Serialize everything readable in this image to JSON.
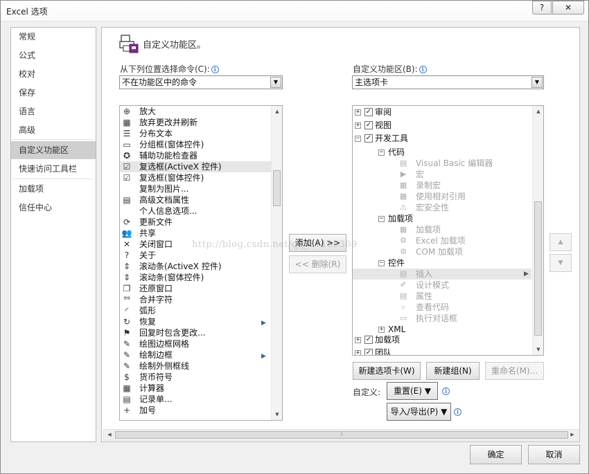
{
  "window": {
    "title": "Excel 选项",
    "help_label": "?",
    "close_label": "✕"
  },
  "nav": {
    "items": [
      {
        "label": "常规"
      },
      {
        "label": "公式"
      },
      {
        "label": "校对"
      },
      {
        "label": "保存"
      },
      {
        "label": "语言"
      },
      {
        "label": "高级"
      },
      {
        "label": "自定义功能区",
        "selected": true
      },
      {
        "label": "快速访问工具栏"
      },
      {
        "label": "加载项"
      },
      {
        "label": "信任中心"
      }
    ]
  },
  "main": {
    "heading": "自定义功能区。",
    "heading_icon": "ribbon-customize-icon",
    "choose_from_label": "从下列位置选择命令(C):",
    "choose_from_value": "不在功能区中的命令",
    "customize_ribbon_label": "自定义功能区(B):",
    "customize_ribbon_value": "主选项卡",
    "info_icon_glyph": "i",
    "combo_arrow_glyph": "▼",
    "commands": [
      {
        "label": "放大",
        "icon": "zoom-in-icon",
        "glyph": "⊕"
      },
      {
        "label": "放弃更改并刷新",
        "icon": "discard-refresh-icon",
        "glyph": "▦"
      },
      {
        "label": "分布文本",
        "icon": "distribute-text-icon",
        "glyph": "☰"
      },
      {
        "label": "分组框(窗体控件)",
        "icon": "group-box-icon",
        "glyph": "▭"
      },
      {
        "label": "辅助功能检查器",
        "icon": "accessibility-icon",
        "glyph": "✪"
      },
      {
        "label": "复选框(ActiveX 控件)",
        "icon": "checkbox-activex-icon",
        "glyph": "☑",
        "highlighted": true
      },
      {
        "label": "复选框(窗体控件)",
        "icon": "checkbox-form-icon",
        "glyph": "☑"
      },
      {
        "label": "复制为图片...",
        "icon": "",
        "glyph": ""
      },
      {
        "label": "高级文档属性",
        "icon": "doc-properties-icon",
        "glyph": "▤"
      },
      {
        "label": "个人信息选项...",
        "icon": "",
        "glyph": ""
      },
      {
        "label": "更新文件",
        "icon": "update-file-icon",
        "glyph": "⟳"
      },
      {
        "label": "共享",
        "icon": "share-icon",
        "glyph": "👥"
      },
      {
        "label": "关闭窗口",
        "icon": "close-window-icon",
        "glyph": "✕"
      },
      {
        "label": "关于",
        "icon": "about-icon",
        "glyph": "?"
      },
      {
        "label": "滚动条(ActiveX 控件)",
        "icon": "scrollbar-activex-icon",
        "glyph": "⇕"
      },
      {
        "label": "滚动条(窗体控件)",
        "icon": "scrollbar-form-icon",
        "glyph": "⇕"
      },
      {
        "label": "还原窗口",
        "icon": "restore-window-icon",
        "glyph": "❐"
      },
      {
        "label": "合并字符",
        "icon": "combine-chars-icon",
        "glyph": "⁹⁹"
      },
      {
        "label": "弧形",
        "icon": "arc-icon",
        "glyph": "◜"
      },
      {
        "label": "恢复",
        "icon": "recover-icon",
        "glyph": "↻",
        "submenu": true
      },
      {
        "label": "回复时包含更改...",
        "icon": "reply-changes-icon",
        "glyph": "⚑"
      },
      {
        "label": "绘图边框网格",
        "icon": "draw-border-grid-icon",
        "glyph": "✎"
      },
      {
        "label": "绘制边框",
        "icon": "draw-border-icon",
        "glyph": "✎",
        "submenu": true
      },
      {
        "label": "绘制外侧框线",
        "icon": "draw-outside-border-icon",
        "glyph": "✎"
      },
      {
        "label": "货币符号",
        "icon": "currency-icon",
        "glyph": "$"
      },
      {
        "label": "计算器",
        "icon": "calculator-icon",
        "glyph": "▦"
      },
      {
        "label": "记录单...",
        "icon": "form-icon",
        "glyph": "▤"
      },
      {
        "label": "加号",
        "icon": "plus-icon",
        "glyph": "+"
      }
    ],
    "add_button": "添加(A) >>",
    "remove_button": "<< 删除(R)",
    "tree": [
      {
        "label": "审阅",
        "level": 0,
        "expander": "+",
        "checked": true
      },
      {
        "label": "视图",
        "level": 0,
        "expander": "+",
        "checked": true
      },
      {
        "label": "开发工具",
        "level": 0,
        "expander": "−",
        "checked": true
      },
      {
        "label": "代码",
        "level": 1,
        "expander": "−"
      },
      {
        "label": "Visual Basic 编辑器",
        "level": 2,
        "icon": "vba-editor-icon",
        "glyph": "▤"
      },
      {
        "label": "宏",
        "level": 2,
        "icon": "macro-icon",
        "glyph": "▶"
      },
      {
        "label": "录制宏",
        "level": 2,
        "icon": "record-macro-icon",
        "glyph": "▦"
      },
      {
        "label": "使用相对引用",
        "level": 2,
        "icon": "relative-ref-icon",
        "glyph": "▦"
      },
      {
        "label": "宏安全性",
        "level": 2,
        "icon": "macro-security-icon",
        "glyph": "⚠"
      },
      {
        "label": "加载项",
        "level": 1,
        "expander": "−"
      },
      {
        "label": "加载项",
        "level": 2,
        "icon": "addins-icon",
        "glyph": "▦"
      },
      {
        "label": "Excel 加载项",
        "level": 2,
        "icon": "excel-addins-icon",
        "glyph": "⚙"
      },
      {
        "label": "COM 加载项",
        "level": 2,
        "icon": "com-addins-icon",
        "glyph": "⚙"
      },
      {
        "label": "控件",
        "level": 1,
        "expander": "−"
      },
      {
        "label": "插入",
        "level": 2,
        "icon": "insert-control-icon",
        "glyph": "▤",
        "highlighted": true,
        "submenu": true
      },
      {
        "label": "设计模式",
        "level": 2,
        "icon": "design-mode-icon",
        "glyph": "✐"
      },
      {
        "label": "属性",
        "level": 2,
        "icon": "properties-icon",
        "glyph": "▤"
      },
      {
        "label": "查看代码",
        "level": 2,
        "icon": "view-code-icon",
        "glyph": "⌕"
      },
      {
        "label": "执行对话框",
        "level": 2,
        "icon": "run-dialog-icon",
        "glyph": "▭"
      },
      {
        "label": "XML",
        "level": 1,
        "expander": "+"
      },
      {
        "label": "加载项",
        "level": 0,
        "expander": "+",
        "checked": true
      },
      {
        "label": "团队",
        "level": 0,
        "expander": "+",
        "checked": true
      }
    ],
    "new_tab_button": "新建选项卡(W)",
    "new_group_button": "新建组(N)",
    "rename_button": "重命名(M)...",
    "customize_label": "自定义:",
    "reset_button": "重置(E) ▼",
    "import_export_button": "导入/导出(P) ▼",
    "move_up_glyph": "▲",
    "move_down_glyph": "▼"
  },
  "footer": {
    "ok_button": "确定",
    "cancel_button": "取消"
  },
  "watermark": "http://blog.csdn.net/qq_31150309"
}
